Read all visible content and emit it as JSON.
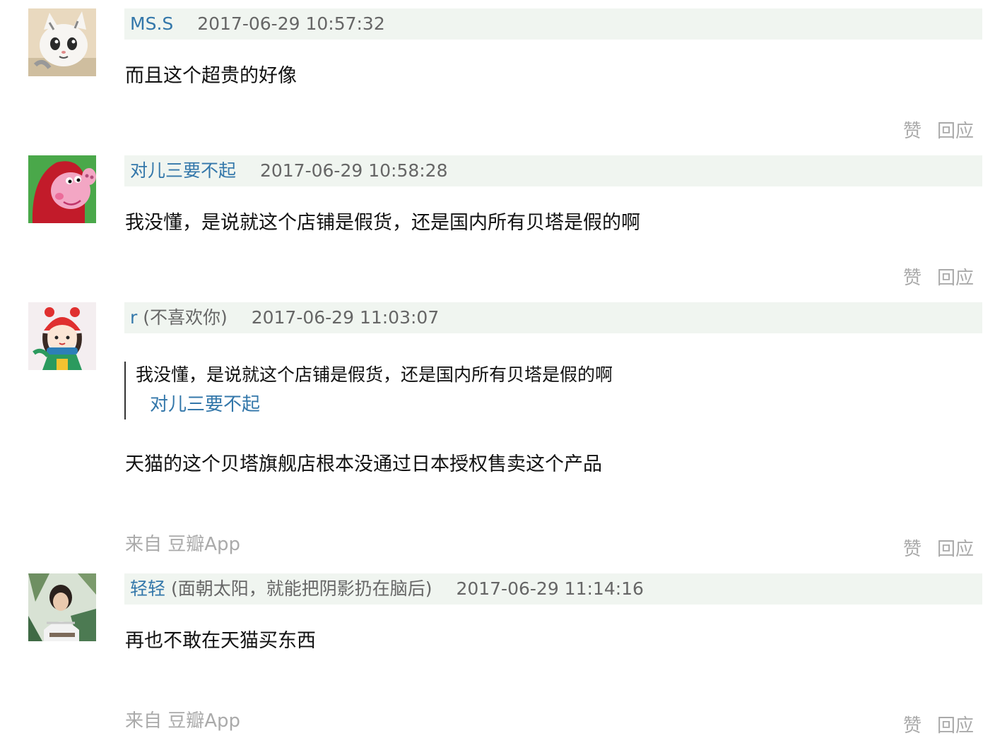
{
  "actions": {
    "like_label": "赞",
    "reply_label": "回应"
  },
  "comments": [
    {
      "author": "MS.S",
      "signature": "",
      "time": "2017-06-29 10:57:32",
      "text": "而且这个超贵的好像",
      "avatar_icon": "chi-cat-avatar-icon"
    },
    {
      "author": "对儿三要不起",
      "signature": "",
      "time": "2017-06-29 10:58:28",
      "text": "我没懂，是说就这个店铺是假货，还是国内所有贝塔是假的啊",
      "avatar_icon": "peppa-pig-avatar-icon"
    },
    {
      "author": "r",
      "signature": "(不喜欢你)",
      "time": "2017-06-29 11:03:07",
      "quote": {
        "text": "我没懂，是说就这个店铺是假货，还是国内所有贝塔是假的啊",
        "author": "对儿三要不起"
      },
      "text": "天猫的这个贝塔旗舰店根本没通过日本授权售卖这个产品",
      "source": "来自 豆瓣App",
      "avatar_icon": "cartoon-girl-avatar-icon"
    },
    {
      "author": "轻轻",
      "signature": "(面朝太阳，就能把阴影扔在脑后)",
      "time": "2017-06-29 11:14:16",
      "text": "再也不敢在天猫买东西",
      "source": "来自 豆瓣App",
      "avatar_icon": "photo-avatar-icon"
    }
  ],
  "colors": {
    "link": "#3377aa",
    "meta_bg": "#f0f5f0",
    "muted": "#aaaaaa"
  }
}
